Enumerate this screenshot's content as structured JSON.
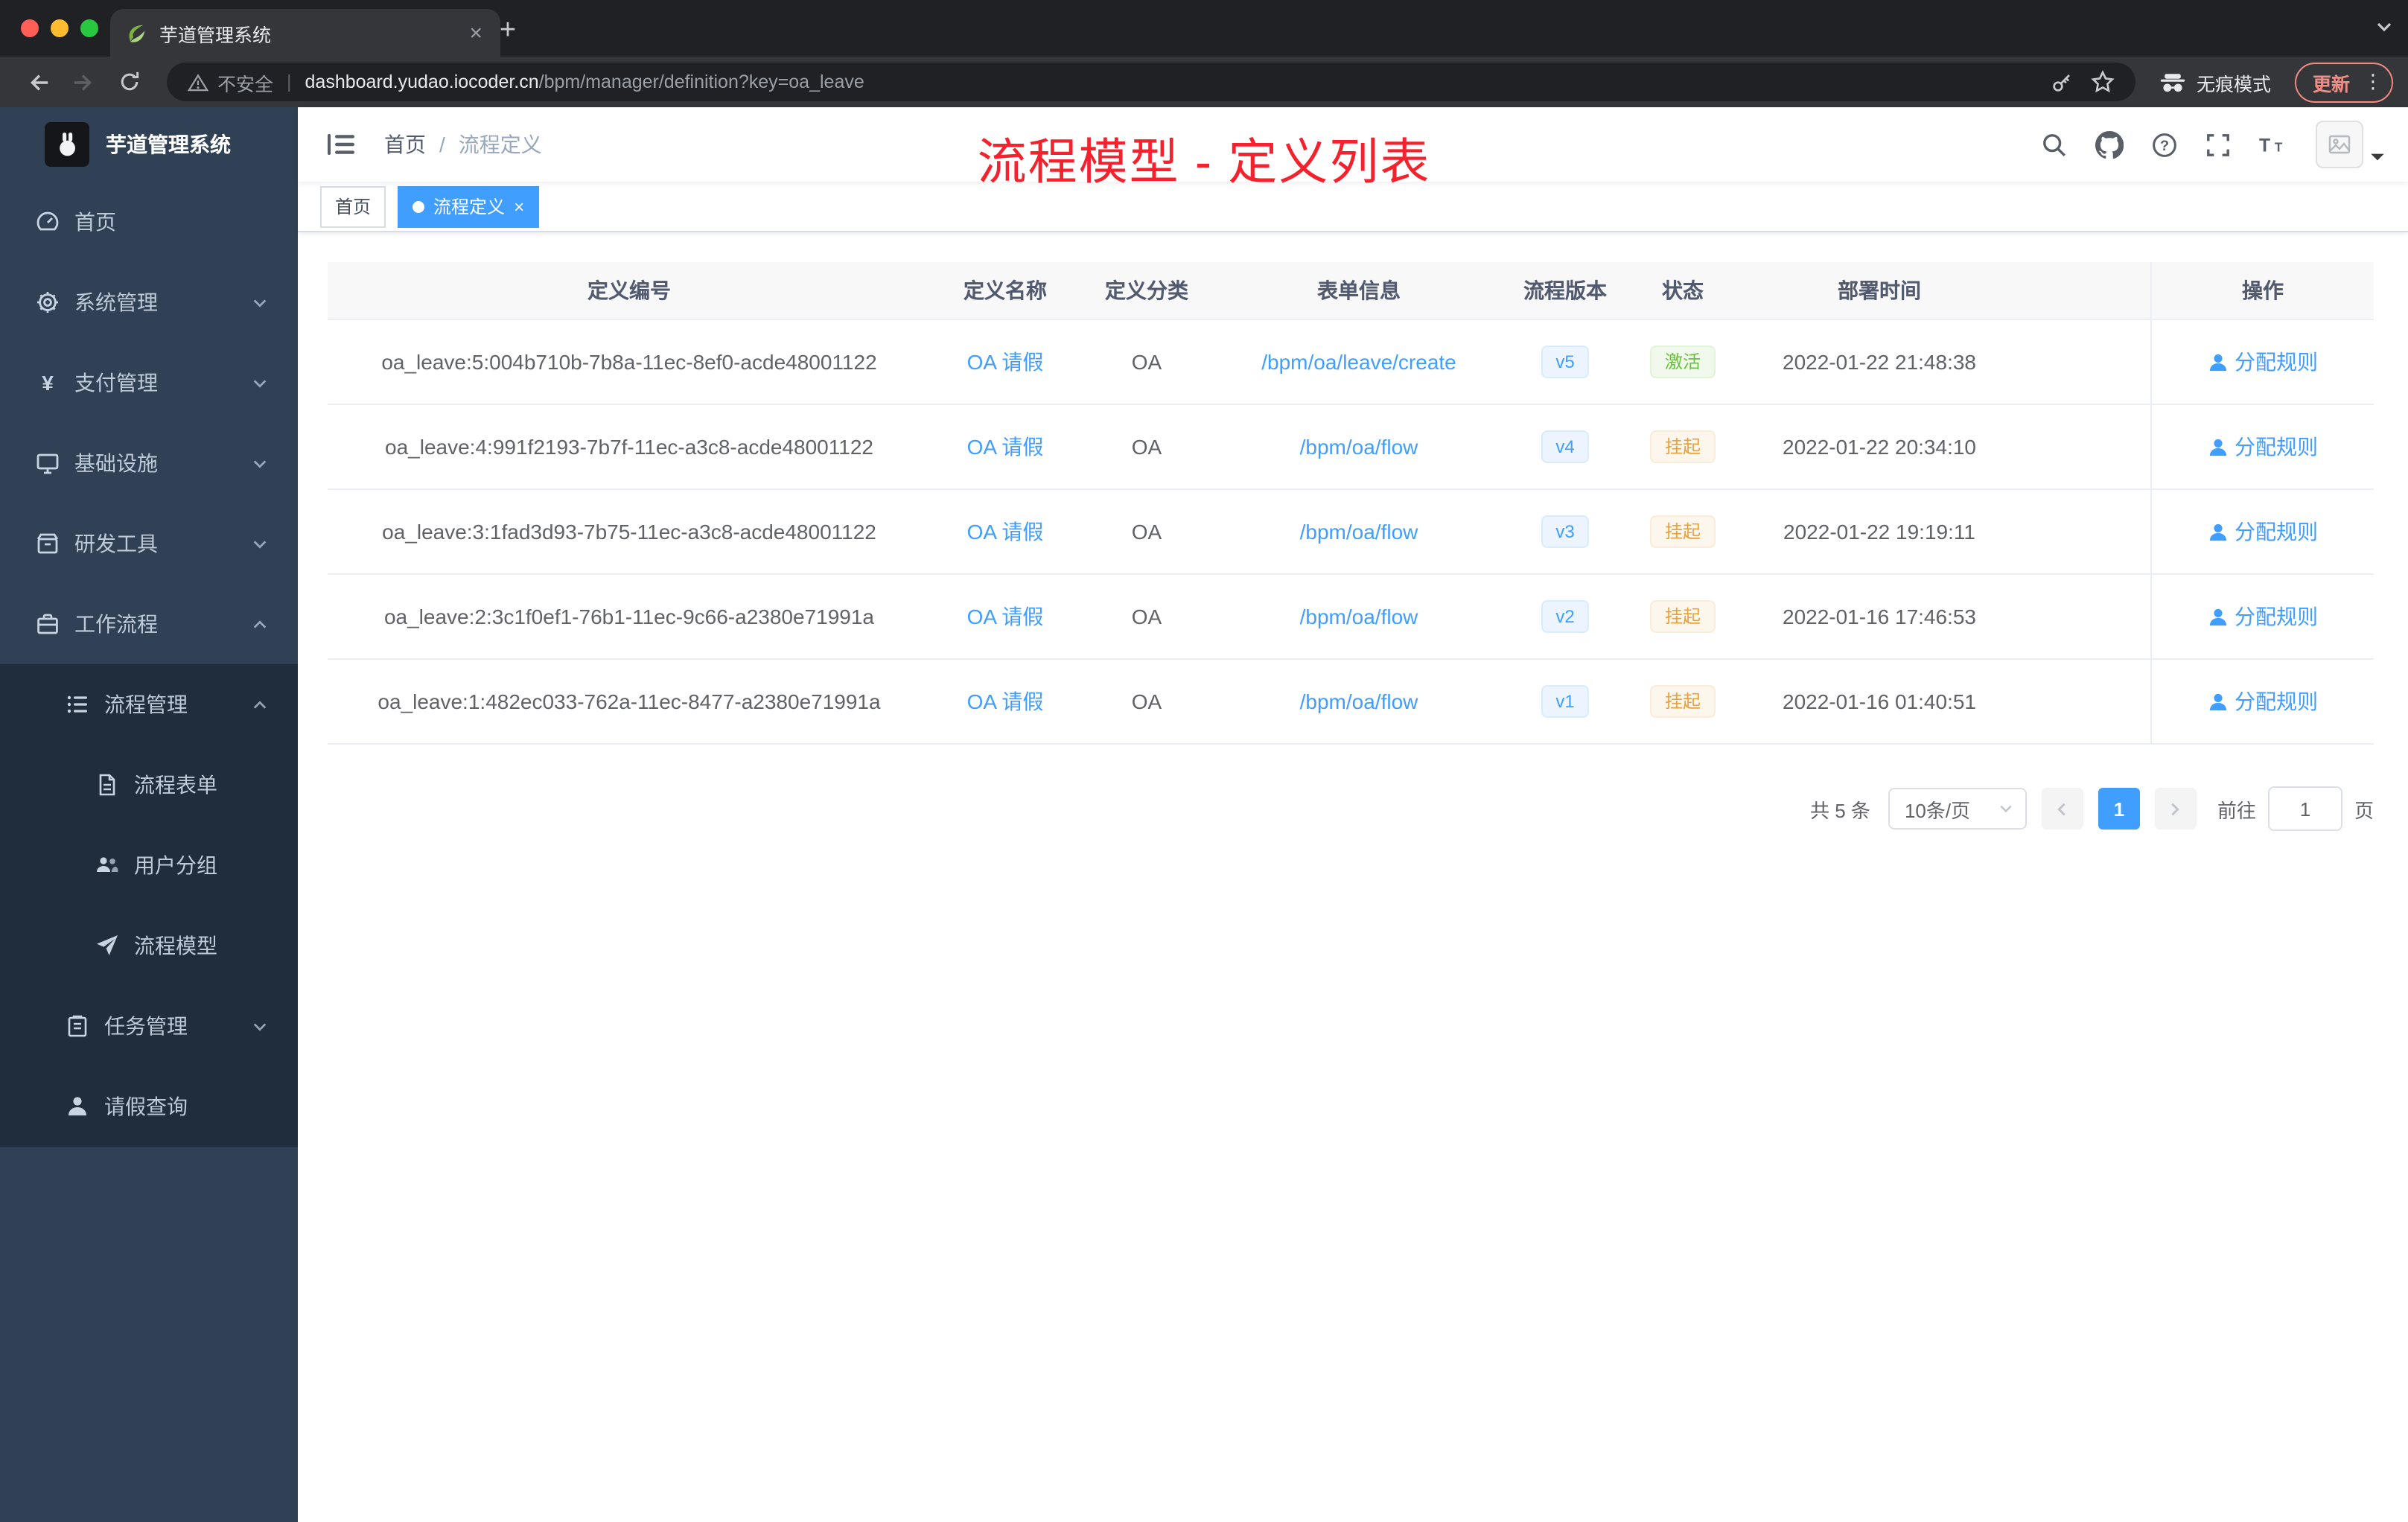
{
  "browser": {
    "tab_title": "芋道管理系统",
    "security_label": "不安全",
    "url_host": "dashboard.yudao.iocoder.cn",
    "url_path": "/bpm/manager/definition?key=oa_leave",
    "incognito_label": "无痕模式",
    "update_label": "更新"
  },
  "sidebar": {
    "logo_title": "芋道管理系统",
    "items": [
      {
        "label": "首页"
      },
      {
        "label": "系统管理"
      },
      {
        "label": "支付管理"
      },
      {
        "label": "基础设施"
      },
      {
        "label": "研发工具"
      },
      {
        "label": "工作流程"
      }
    ],
    "submenu": [
      {
        "label": "流程管理"
      },
      {
        "label": "流程表单"
      },
      {
        "label": "用户分组"
      },
      {
        "label": "流程模型"
      },
      {
        "label": "任务管理"
      },
      {
        "label": "请假查询"
      }
    ]
  },
  "navbar": {
    "breadcrumb": [
      "首页",
      "流程定义"
    ]
  },
  "annotation": "流程模型 - 定义列表",
  "tags": [
    {
      "label": "首页"
    },
    {
      "label": "流程定义"
    }
  ],
  "table": {
    "headers": [
      "定义编号",
      "定义名称",
      "定义分类",
      "表单信息",
      "流程版本",
      "状态",
      "部署时间",
      "操作"
    ],
    "rows": [
      {
        "id": "oa_leave:5:004b710b-7b8a-11ec-8ef0-acde48001122",
        "name": "OA 请假",
        "category": "OA",
        "form": "/bpm/oa/leave/create",
        "version": "v5",
        "status": "激活",
        "status_type": "success",
        "deploy_time": "2022-01-22 21:48:38",
        "action": "分配规则"
      },
      {
        "id": "oa_leave:4:991f2193-7b7f-11ec-a3c8-acde48001122",
        "name": "OA 请假",
        "category": "OA",
        "form": "/bpm/oa/flow",
        "version": "v4",
        "status": "挂起",
        "status_type": "warning",
        "deploy_time": "2022-01-22 20:34:10",
        "action": "分配规则"
      },
      {
        "id": "oa_leave:3:1fad3d93-7b75-11ec-a3c8-acde48001122",
        "name": "OA 请假",
        "category": "OA",
        "form": "/bpm/oa/flow",
        "version": "v3",
        "status": "挂起",
        "status_type": "warning",
        "deploy_time": "2022-01-22 19:19:11",
        "action": "分配规则"
      },
      {
        "id": "oa_leave:2:3c1f0ef1-76b1-11ec-9c66-a2380e71991a",
        "name": "OA 请假",
        "category": "OA",
        "form": "/bpm/oa/flow",
        "version": "v2",
        "status": "挂起",
        "status_type": "warning",
        "deploy_time": "2022-01-16 17:46:53",
        "action": "分配规则"
      },
      {
        "id": "oa_leave:1:482ec033-762a-11ec-8477-a2380e71991a",
        "name": "OA 请假",
        "category": "OA",
        "form": "/bpm/oa/flow",
        "version": "v1",
        "status": "挂起",
        "status_type": "warning",
        "deploy_time": "2022-01-16 01:40:51",
        "action": "分配规则"
      }
    ]
  },
  "pagination": {
    "total": "共 5 条",
    "page_size": "10条/页",
    "current_page": "1",
    "goto_prefix": "前往",
    "goto_value": "1",
    "goto_suffix": "页"
  }
}
